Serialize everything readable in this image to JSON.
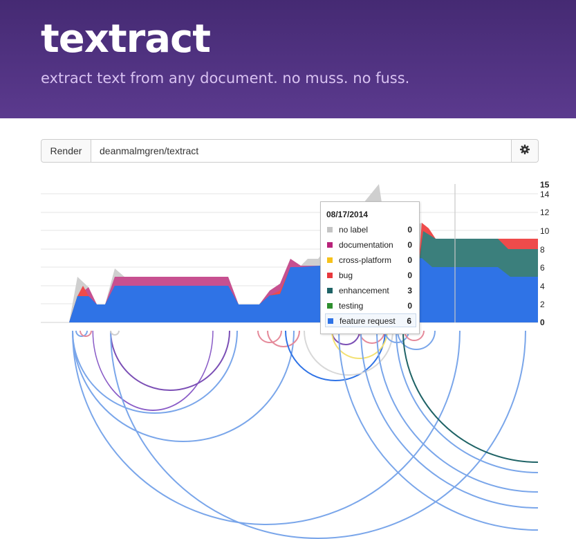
{
  "header": {
    "title": "textract",
    "tagline": "extract text from any document. no muss. no fuss."
  },
  "toolbar": {
    "render_label": "Render",
    "repo_value": "deanmalmgren/textract",
    "settings_icon": "gear-icon"
  },
  "chart_data": {
    "type": "area",
    "stacked": true,
    "y_ticks": [
      "0",
      "2",
      "4",
      "6",
      "8",
      "10",
      "12",
      "14",
      "15"
    ],
    "ylim": [
      0,
      15
    ],
    "grid": true,
    "series": [
      {
        "name": "feature request",
        "color": "#2f73e6"
      },
      {
        "name": "enhancement",
        "color": "#3b7f7c"
      },
      {
        "name": "bug",
        "color": "#ef4b4b"
      },
      {
        "name": "documentation",
        "color": "#c75090"
      },
      {
        "name": "cross-platform",
        "color": "#f4c21a"
      },
      {
        "name": "testing",
        "color": "#2e8b2e"
      },
      {
        "name": "no label",
        "color": "#c9c9c9"
      }
    ]
  },
  "tooltip": {
    "date": "08/17/2014",
    "rows": [
      {
        "label": "no label",
        "value": "0",
        "color": "#c4c4c4"
      },
      {
        "label": "documentation",
        "value": "0",
        "color": "#b8237a"
      },
      {
        "label": "cross-platform",
        "value": "0",
        "color": "#f6c21b"
      },
      {
        "label": "bug",
        "value": "0",
        "color": "#e8383d"
      },
      {
        "label": "enhancement",
        "value": "3",
        "color": "#1f6366"
      },
      {
        "label": "testing",
        "value": "0",
        "color": "#2f8f2f"
      },
      {
        "label": "feature request",
        "value": "6",
        "color": "#2f73e6"
      }
    ]
  }
}
